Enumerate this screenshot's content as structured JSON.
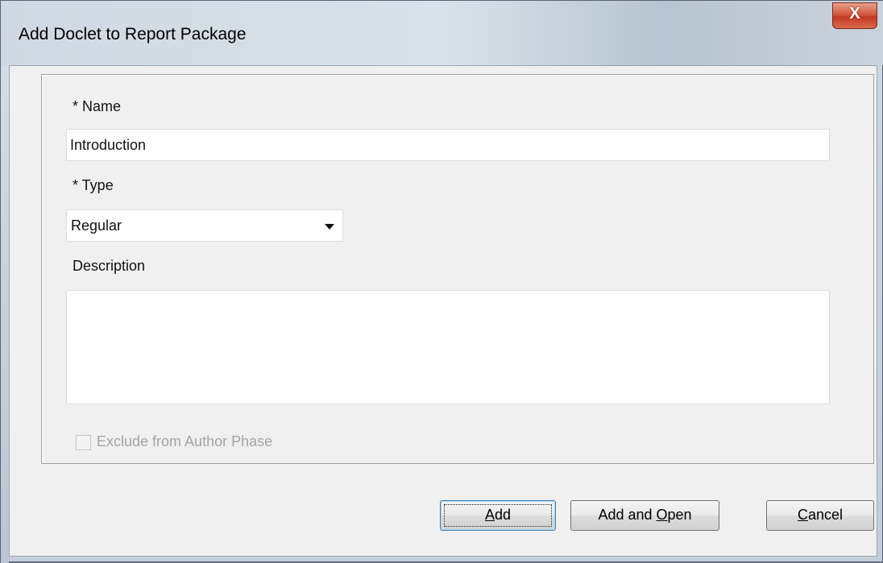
{
  "window": {
    "title": "Add Doclet to Report Package",
    "close_symbol": "X"
  },
  "form": {
    "name_label": "* Name",
    "name_value": "Introduction",
    "type_label": "* Type",
    "type_value": "Regular",
    "description_label": "Description",
    "description_value": "",
    "exclude_label": "Exclude from Author Phase",
    "exclude_checked": false
  },
  "buttons": {
    "add": {
      "pre": "",
      "mnemonic": "A",
      "post": "dd"
    },
    "add_open": {
      "pre": "Add and ",
      "mnemonic": "O",
      "post": "pen"
    },
    "cancel": {
      "pre": "",
      "mnemonic": "C",
      "post": "ancel"
    }
  },
  "colors": {
    "close_button": "#c23a22",
    "dialog_bg": "#f0f0f0",
    "disabled_text": "#a3a3a3"
  }
}
